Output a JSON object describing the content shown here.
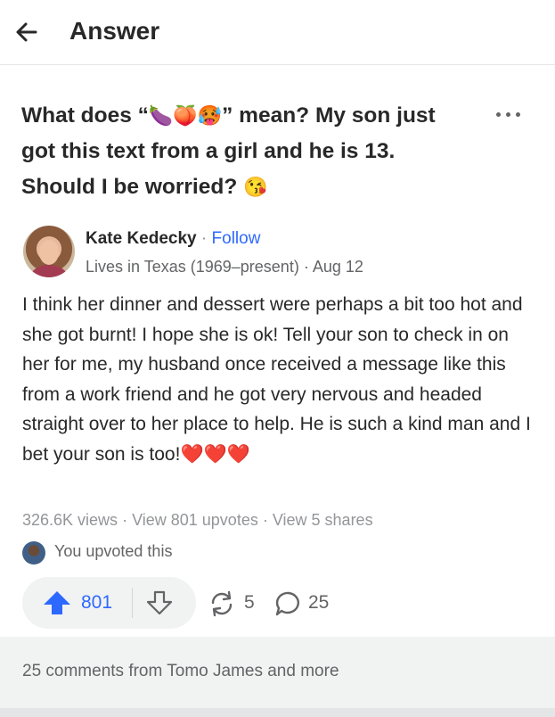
{
  "header": {
    "title": "Answer",
    "back_icon": "arrow-left-icon"
  },
  "question": {
    "part1": "What does “",
    "emojis": "🍆🍑🥵",
    "part2": "” mean? My son just got this text from a girl and he is 13. Should I be worried? ",
    "end_emoji": "😘",
    "more_icon": "ellipsis-icon"
  },
  "author": {
    "name": "Kate Kedecky",
    "separator": " · ",
    "follow_label": "Follow",
    "credential": "Lives in Texas (1969–present)",
    "date": "Aug 12"
  },
  "answer": {
    "text": "I think her dinner and dessert were perhaps a bit too hot and she got burnt! I hope she is ok! Tell your son to check in on her for me, my husband once received a message like this from a work friend and he got very nervous and headed straight over to her place to help. He is such a kind man and I bet your son is too!",
    "hearts": "❤️❤️❤️"
  },
  "stats": {
    "views": "326.6K views",
    "upvotes_link": "View 801 upvotes",
    "shares_link": "View 5 shares",
    "separator": " · "
  },
  "upvoted": {
    "text": "You upvoted this"
  },
  "actions": {
    "upvote_count": "801",
    "share_count": "5",
    "comment_count": "25",
    "upvote_color": "#2e69ff"
  },
  "footer": {
    "text": "25 comments from Tomo James and more"
  }
}
